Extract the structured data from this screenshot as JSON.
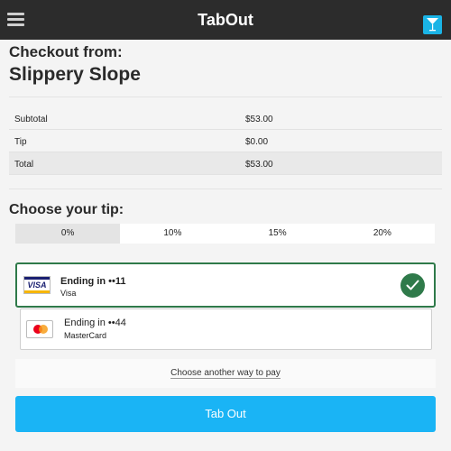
{
  "header": {
    "title": "TabOut",
    "menu_icon": "hamburger-icon",
    "action_icon": "cocktail-glass-icon"
  },
  "checkout": {
    "heading": "Checkout from:",
    "venue": "Slippery Slope"
  },
  "summary": {
    "rows": [
      {
        "label": "Subtotal",
        "value": "$53.00"
      },
      {
        "label": "Tip",
        "value": "$0.00"
      },
      {
        "label": "Total",
        "value": "$53.00"
      }
    ]
  },
  "tip": {
    "heading": "Choose your tip:",
    "options": [
      "0%",
      "10%",
      "15%",
      "20%"
    ],
    "selected": "0%"
  },
  "cards": [
    {
      "ending": "Ending in ••11",
      "brand": "Visa",
      "logo_text": "VISA",
      "selected": true
    },
    {
      "ending": "Ending in ••44",
      "brand": "MasterCard",
      "selected": false
    }
  ],
  "another_way": "Choose another way to pay",
  "submit_label": "Tab Out",
  "colors": {
    "topbar": "#2c2c2c",
    "accent": "#1ab4f5",
    "selected_card": "#2f7a4a"
  }
}
